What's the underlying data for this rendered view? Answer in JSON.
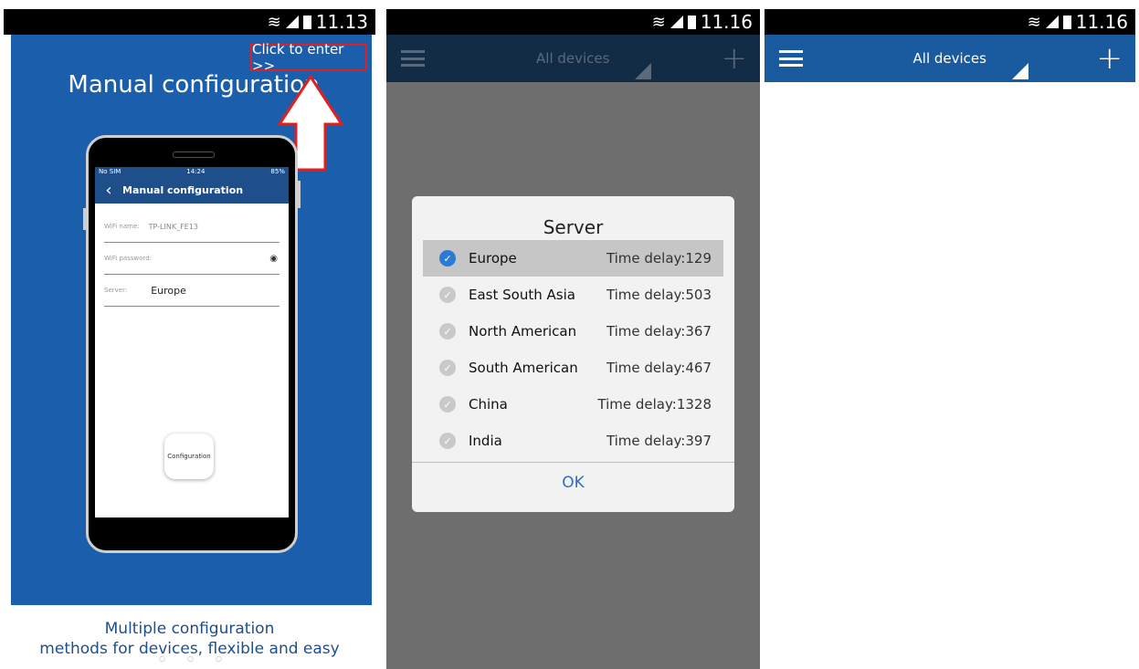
{
  "screen1": {
    "time": "11.13",
    "click_to_enter": "Click to enter >>",
    "title": "Manual configuration",
    "phone": {
      "carrier": "No SIM",
      "time": "14:24",
      "battery": "85%",
      "header": "Manual configuration",
      "wifi_name_label": "WiFi name:",
      "wifi_name_value": "TP-LINK_FE13",
      "wifi_password_label": "WiFi password:",
      "server_label": "Server:",
      "server_value": "Europe",
      "configuration_button": "Configuration"
    },
    "bottom_line1": "Multiple configuration",
    "bottom_line2": "methods for devices, flexible and easy"
  },
  "screen2": {
    "time": "11.16",
    "header_title": "All devices",
    "dialog": {
      "title": "Server",
      "ok": "OK",
      "servers": [
        {
          "name": "Europe",
          "delay": "Time delay:129",
          "selected": true
        },
        {
          "name": "East South Asia",
          "delay": "Time delay:503",
          "selected": false
        },
        {
          "name": "North American",
          "delay": "Time delay:367",
          "selected": false
        },
        {
          "name": "South American",
          "delay": "Time delay:467",
          "selected": false
        },
        {
          "name": "China",
          "delay": "Time delay:1328",
          "selected": false
        },
        {
          "name": "India",
          "delay": "Time delay:397",
          "selected": false
        }
      ]
    }
  },
  "screen3": {
    "time": "11.16",
    "header_title": "All devices"
  },
  "colors": {
    "blue_panel": "#1b5eab",
    "header_blue": "#1a5a9e",
    "accent": "#2b7bd6",
    "highlight_red": "#e02020"
  }
}
